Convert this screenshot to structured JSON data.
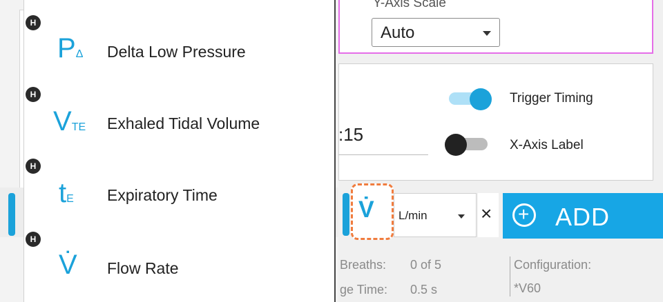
{
  "y_axis_card": {
    "title": "Y-Axis Scale",
    "select_value": "Auto"
  },
  "settings_card": {
    "time_value": ":15",
    "toggles": [
      {
        "label": "Trigger Timing",
        "on": true
      },
      {
        "label": "X-Axis Label",
        "on": false
      }
    ]
  },
  "toolbar": {
    "selected_param_icon": "flow-rate-icon",
    "selected_param_symbol": "V̇",
    "unit_value": "L/min",
    "close_label": "×",
    "add_label": "ADD"
  },
  "stats": {
    "breaths_label": "Breaths:",
    "breaths_value": "0 of 5",
    "time_label": "ge Time:",
    "time_value": "0.5 s",
    "config_label": "Configuration:",
    "config_value": "*V60"
  },
  "menu": {
    "items": [
      {
        "badge": "H",
        "symbol": "P",
        "subscript": "Δ",
        "label": "Delta Low Pressure",
        "icon": "delta-low-pressure-icon"
      },
      {
        "badge": "H",
        "symbol": "V",
        "subscript": "TE",
        "label": "Exhaled Tidal Volume",
        "icon": "exhaled-tidal-volume-icon"
      },
      {
        "badge": "H",
        "symbol": "t",
        "subscript": "E",
        "label": "Expiratory Time",
        "icon": "expiratory-time-icon"
      },
      {
        "badge": "H",
        "symbol": "V̇",
        "subscript": "",
        "label": "Flow Rate",
        "icon": "flow-rate-icon"
      }
    ]
  },
  "colors": {
    "accent": "#1ba2da",
    "add_button": "#17a6e5",
    "highlight_dashed": "#f07c3e",
    "card_border_pink": "#e56de8"
  }
}
